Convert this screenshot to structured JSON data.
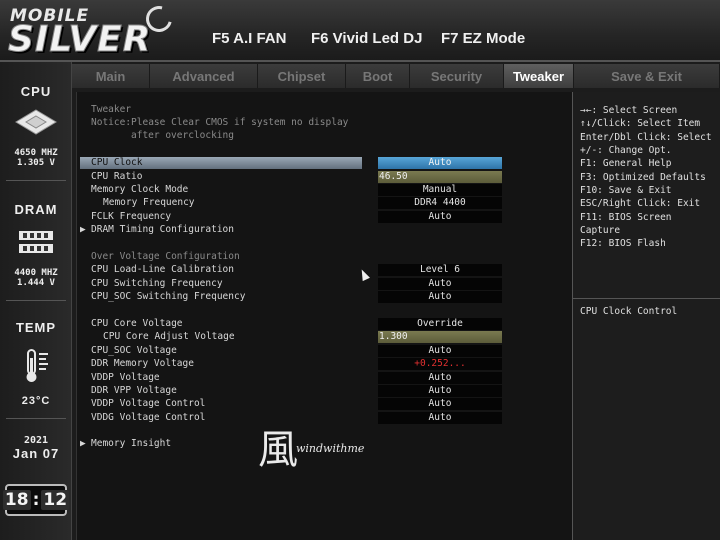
{
  "header": {
    "logo_top": "MOBILE",
    "logo_main": "SILVER",
    "hotkeys": [
      "F5 A.I FAN",
      "F6 Vivid Led DJ",
      "F7 EZ Mode"
    ]
  },
  "sidebar": {
    "cpu_label": "CPU",
    "cpu_freq": "4650 MHZ",
    "cpu_volt": "1.305 V",
    "dram_label": "DRAM",
    "dram_freq": "4400 MHZ",
    "dram_volt": "1.444 V",
    "temp_label": "TEMP",
    "temp_value": "23°C",
    "year": "2021",
    "date": "Jan 07",
    "clock_h": "18",
    "clock_m": "12"
  },
  "tabs": [
    {
      "label": "Main"
    },
    {
      "label": "Advanced"
    },
    {
      "label": "Chipset"
    },
    {
      "label": "Boot"
    },
    {
      "label": "Security"
    },
    {
      "label": "Tweaker",
      "active": true
    },
    {
      "label": "Save & Exit"
    }
  ],
  "main": {
    "section_title": "Tweaker",
    "notice_line1": "Notice:Please Clear CMOS if system no display",
    "notice_line2": "after overclocking",
    "rows": [
      {
        "label": "CPU Clock",
        "value": "Auto",
        "highlight": true,
        "style": "sel"
      },
      {
        "label": "CPU Ratio",
        "value": "46.50",
        "style": "edit"
      },
      {
        "label": "Memory Clock Mode",
        "value": "Manual"
      },
      {
        "label": "Memory Frequency",
        "value": "DDR4 4400",
        "indent": true
      },
      {
        "label": "FCLK Frequency",
        "value": "Auto"
      },
      {
        "label": "DRAM Timing Configuration",
        "submenu": true
      },
      {
        "label": "Over Voltage Configuration",
        "dim": true
      },
      {
        "label": "CPU Load-Line Calibration",
        "value": "Level 6"
      },
      {
        "label": "CPU Switching Frequency",
        "value": "Auto"
      },
      {
        "label": "CPU_SOC Switching Frequency",
        "value": "Auto"
      },
      {
        "label": "CPU Core Voltage",
        "value": "Override"
      },
      {
        "label": "CPU Core Adjust Voltage",
        "value": "1.300",
        "indent": true,
        "style": "edit"
      },
      {
        "label": "CPU_SOC Voltage",
        "value": "Auto"
      },
      {
        "label": "DDR Memory Voltage",
        "value": "+0.252...",
        "style": "red"
      },
      {
        "label": "VDDP Voltage",
        "value": "Auto"
      },
      {
        "label": "DDR VPP Voltage",
        "value": "Auto"
      },
      {
        "label": "VDDP Voltage Control",
        "value": "Auto"
      },
      {
        "label": "VDDG Voltage Control",
        "value": "Auto"
      },
      {
        "label": "Memory Insight",
        "submenu": true
      }
    ]
  },
  "help": {
    "keys": [
      "→←: Select Screen",
      "↑↓/Click: Select Item",
      "Enter/Dbl Click: Select",
      "+/-: Change Opt.",
      "F1: General Help",
      "F3: Optimized Defaults",
      "F10: Save & Exit",
      "ESC/Right Click: Exit",
      "F11: BIOS Screen",
      "Capture",
      "F12: BIOS Flash"
    ],
    "description": "CPU Clock Control"
  },
  "watermark": {
    "kanji": "風",
    "name": "windwithme"
  }
}
